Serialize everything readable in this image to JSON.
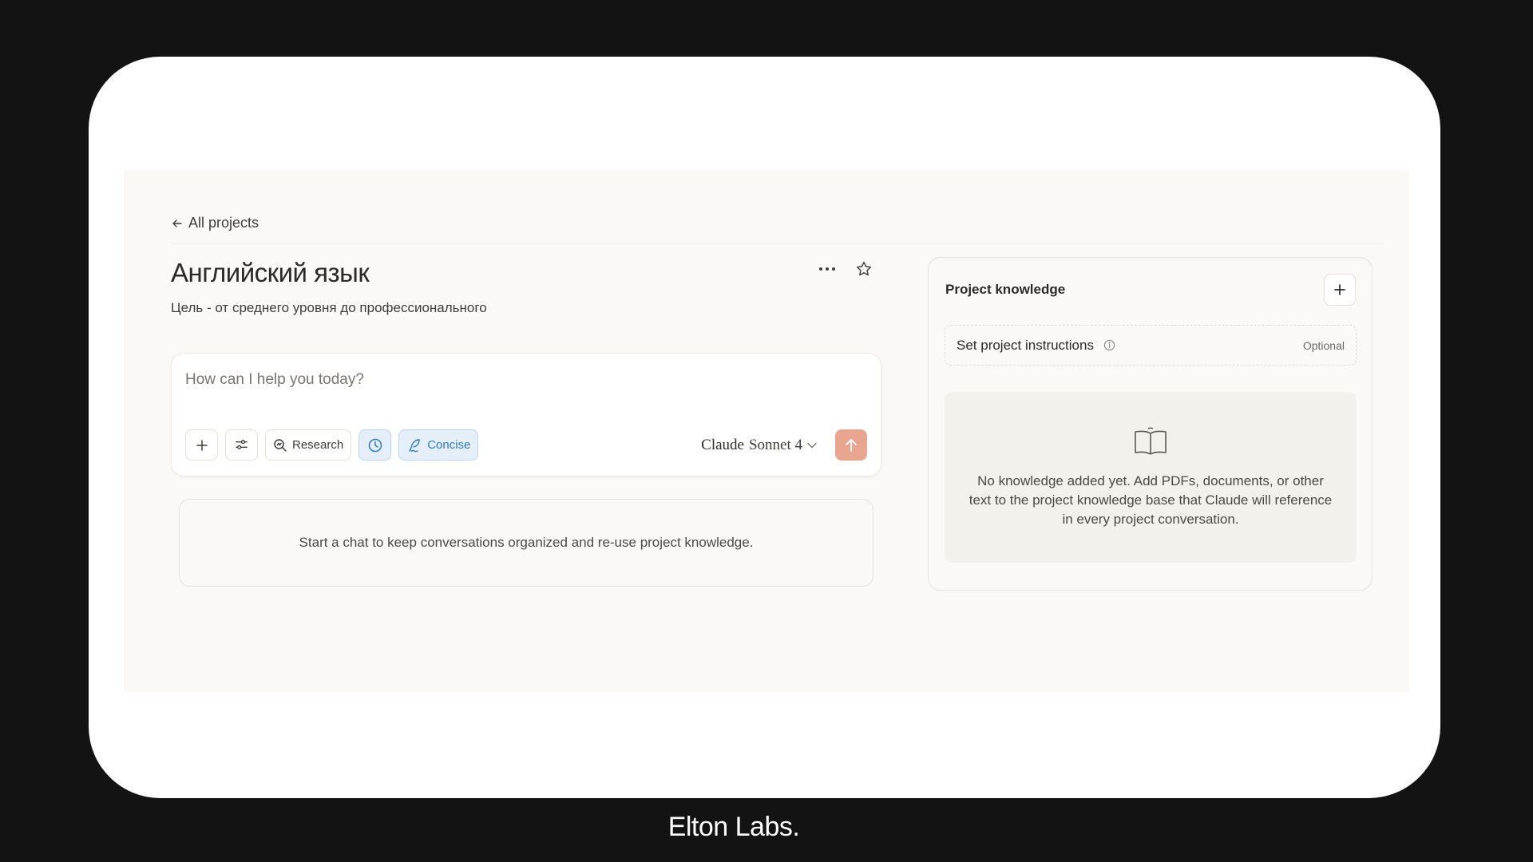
{
  "back_link": {
    "label": "All projects"
  },
  "project": {
    "title": "Английский язык",
    "description": "Цель - от среднего уровня до профессионального"
  },
  "composer": {
    "placeholder": "How can I help you today?",
    "research_label": "Research",
    "concise_label": "Concise",
    "model_brand": "Claude",
    "model_name": "Sonnet 4"
  },
  "chats": {
    "empty_message": "Start a chat to keep conversations organized and re-use project knowledge."
  },
  "knowledge": {
    "title": "Project knowledge",
    "instructions_label": "Set project instructions",
    "optional_label": "Optional",
    "empty_message": "No knowledge added yet. Add PDFs, documents, or other text to the project knowledge base that Claude will reference in every project conversation."
  },
  "colors": {
    "accent_send": "#e8a690",
    "active_tool": "#2f7bc4",
    "background": "#faf9f5"
  },
  "watermark": "Elton Labs."
}
